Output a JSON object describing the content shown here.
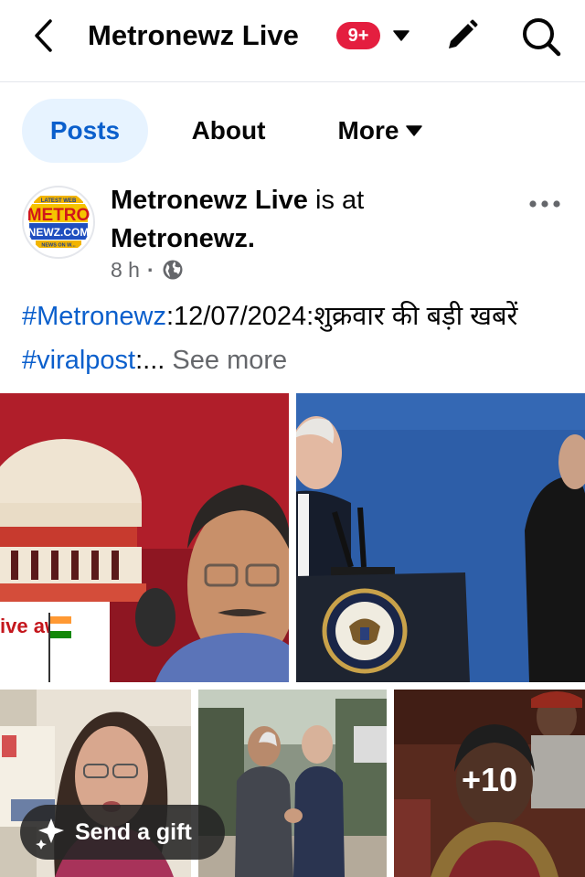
{
  "header": {
    "title": "Metronewz Live",
    "notification_badge": "9+",
    "icons": {
      "back": "chevron-left-icon",
      "caret": "caret-down-icon",
      "edit": "pencil-icon",
      "search": "search-icon"
    }
  },
  "tabs": [
    {
      "label": "Posts",
      "selected": true
    },
    {
      "label": "About",
      "selected": false
    },
    {
      "label": "More",
      "selected": false
    }
  ],
  "post": {
    "author": "Metronewz Live",
    "is_at": "is at",
    "location": "Metronewz.",
    "time": "8 h",
    "dot": "·",
    "audience_icon": "globe-icon",
    "avatar_logo": {
      "top_text": "LATEST WEB",
      "main_text": "METRO",
      "sub_text": "NEWZ.COM",
      "bottom_text": "NEWS ON W..."
    },
    "text": {
      "hashtag1": "#Metronewz",
      "middle": ":12/07/2024:शुक्रवार की बड़ी खबरें ",
      "hashtag2": "#viralpost",
      "trail": ":...",
      "see_more": "See more"
    },
    "photos": [
      {
        "alt": "supreme-court-and-politician",
        "overlay_text": "ive aw"
      },
      {
        "alt": "press-podium-event"
      },
      {
        "alt": "woman-speaking"
      },
      {
        "alt": "two-leaders-handshake"
      },
      {
        "alt": "woman-at-ceremony",
        "more_count": "+10"
      }
    ]
  },
  "gift_button": {
    "label": "Send a gift",
    "icon": "gift-sparkle-icon"
  },
  "colors": {
    "accent_blue": "#0b5fcc",
    "tab_selected_bg": "#e7f3ff",
    "badge_red": "#e41e3f",
    "muted_text": "#65676b"
  }
}
